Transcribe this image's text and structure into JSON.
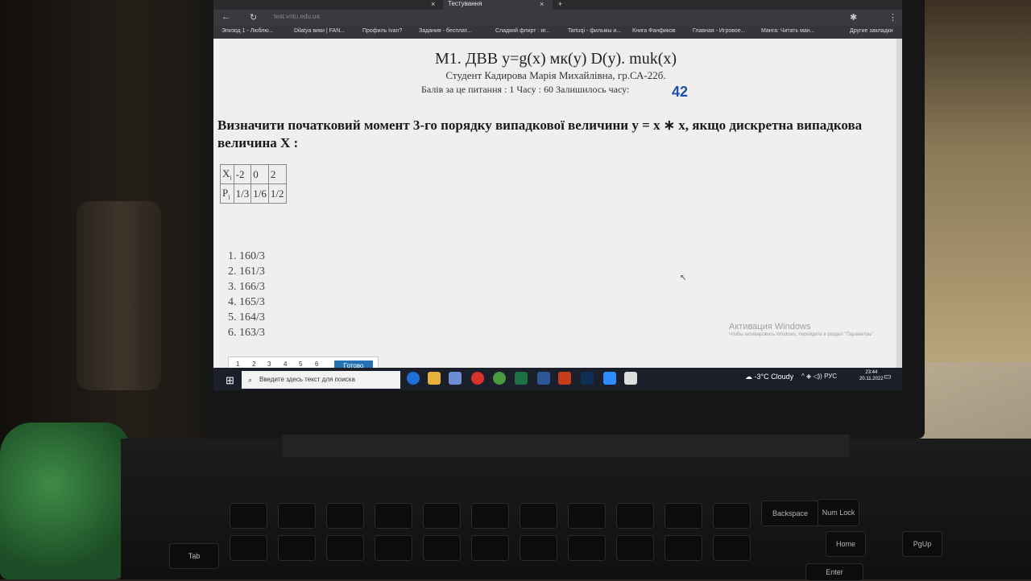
{
  "browser": {
    "tabs": [
      {
        "label": "Тестування",
        "active": true
      }
    ],
    "url_host": "test.vntu.edu.ua",
    "bookmarks": [
      "Эпизод 1 - Люблю...",
      "Dilatya вики | FAN...",
      "Профиль Ivan?",
      "Задания - бесплат...",
      "Сладкий флирт : иг...",
      "Tartuqi - фильмы и...",
      "Книга Фанфиков",
      "Главная - Игровое...",
      "Манга: Читать ман...",
      "Другие закладки"
    ]
  },
  "test": {
    "title": "М1. ДВВ y=g(x) мк(y) D(y). muk(x)",
    "student": "Студент Кадирова Марія Михайлівна, гр.СА-22б.",
    "scores": "Балів за це питання : 1 Часу : 60 Залишилось часу:",
    "time_left": "42",
    "question": "Визначити початковий момент 3-го порядку випадкової величини y = x ∗ x, якщо дискретна випадкова величина X :",
    "table": {
      "row_x": {
        "label": "X",
        "sub": "i",
        "values": [
          "-2",
          "0",
          "2"
        ]
      },
      "row_p": {
        "label": "P",
        "sub": "i",
        "values": [
          "1/3",
          "1/6",
          "1/2"
        ]
      }
    },
    "answers": [
      "1. 160/3",
      "2. 161/3",
      "3. 166/3",
      "4. 165/3",
      "5. 164/3",
      "6. 163/3"
    ],
    "pages": [
      "1",
      "2",
      "3",
      "4",
      "5",
      "6"
    ],
    "done_label": "Готово"
  },
  "windows": {
    "activation_title": "Активация Windows",
    "activation_text": "Чтобы активировать Windows, перейдите в раздел \"Параметры\".",
    "search_placeholder": "Введите здесь текст для поиска",
    "weather": "-3°C Cloudy",
    "lang": "РУС",
    "time": "23:44",
    "date": "20.11.2022"
  },
  "keyboard": {
    "keys": [
      "Backspace",
      "Num Lock",
      "Home",
      "PgUp",
      "Enter",
      "Tab"
    ]
  }
}
